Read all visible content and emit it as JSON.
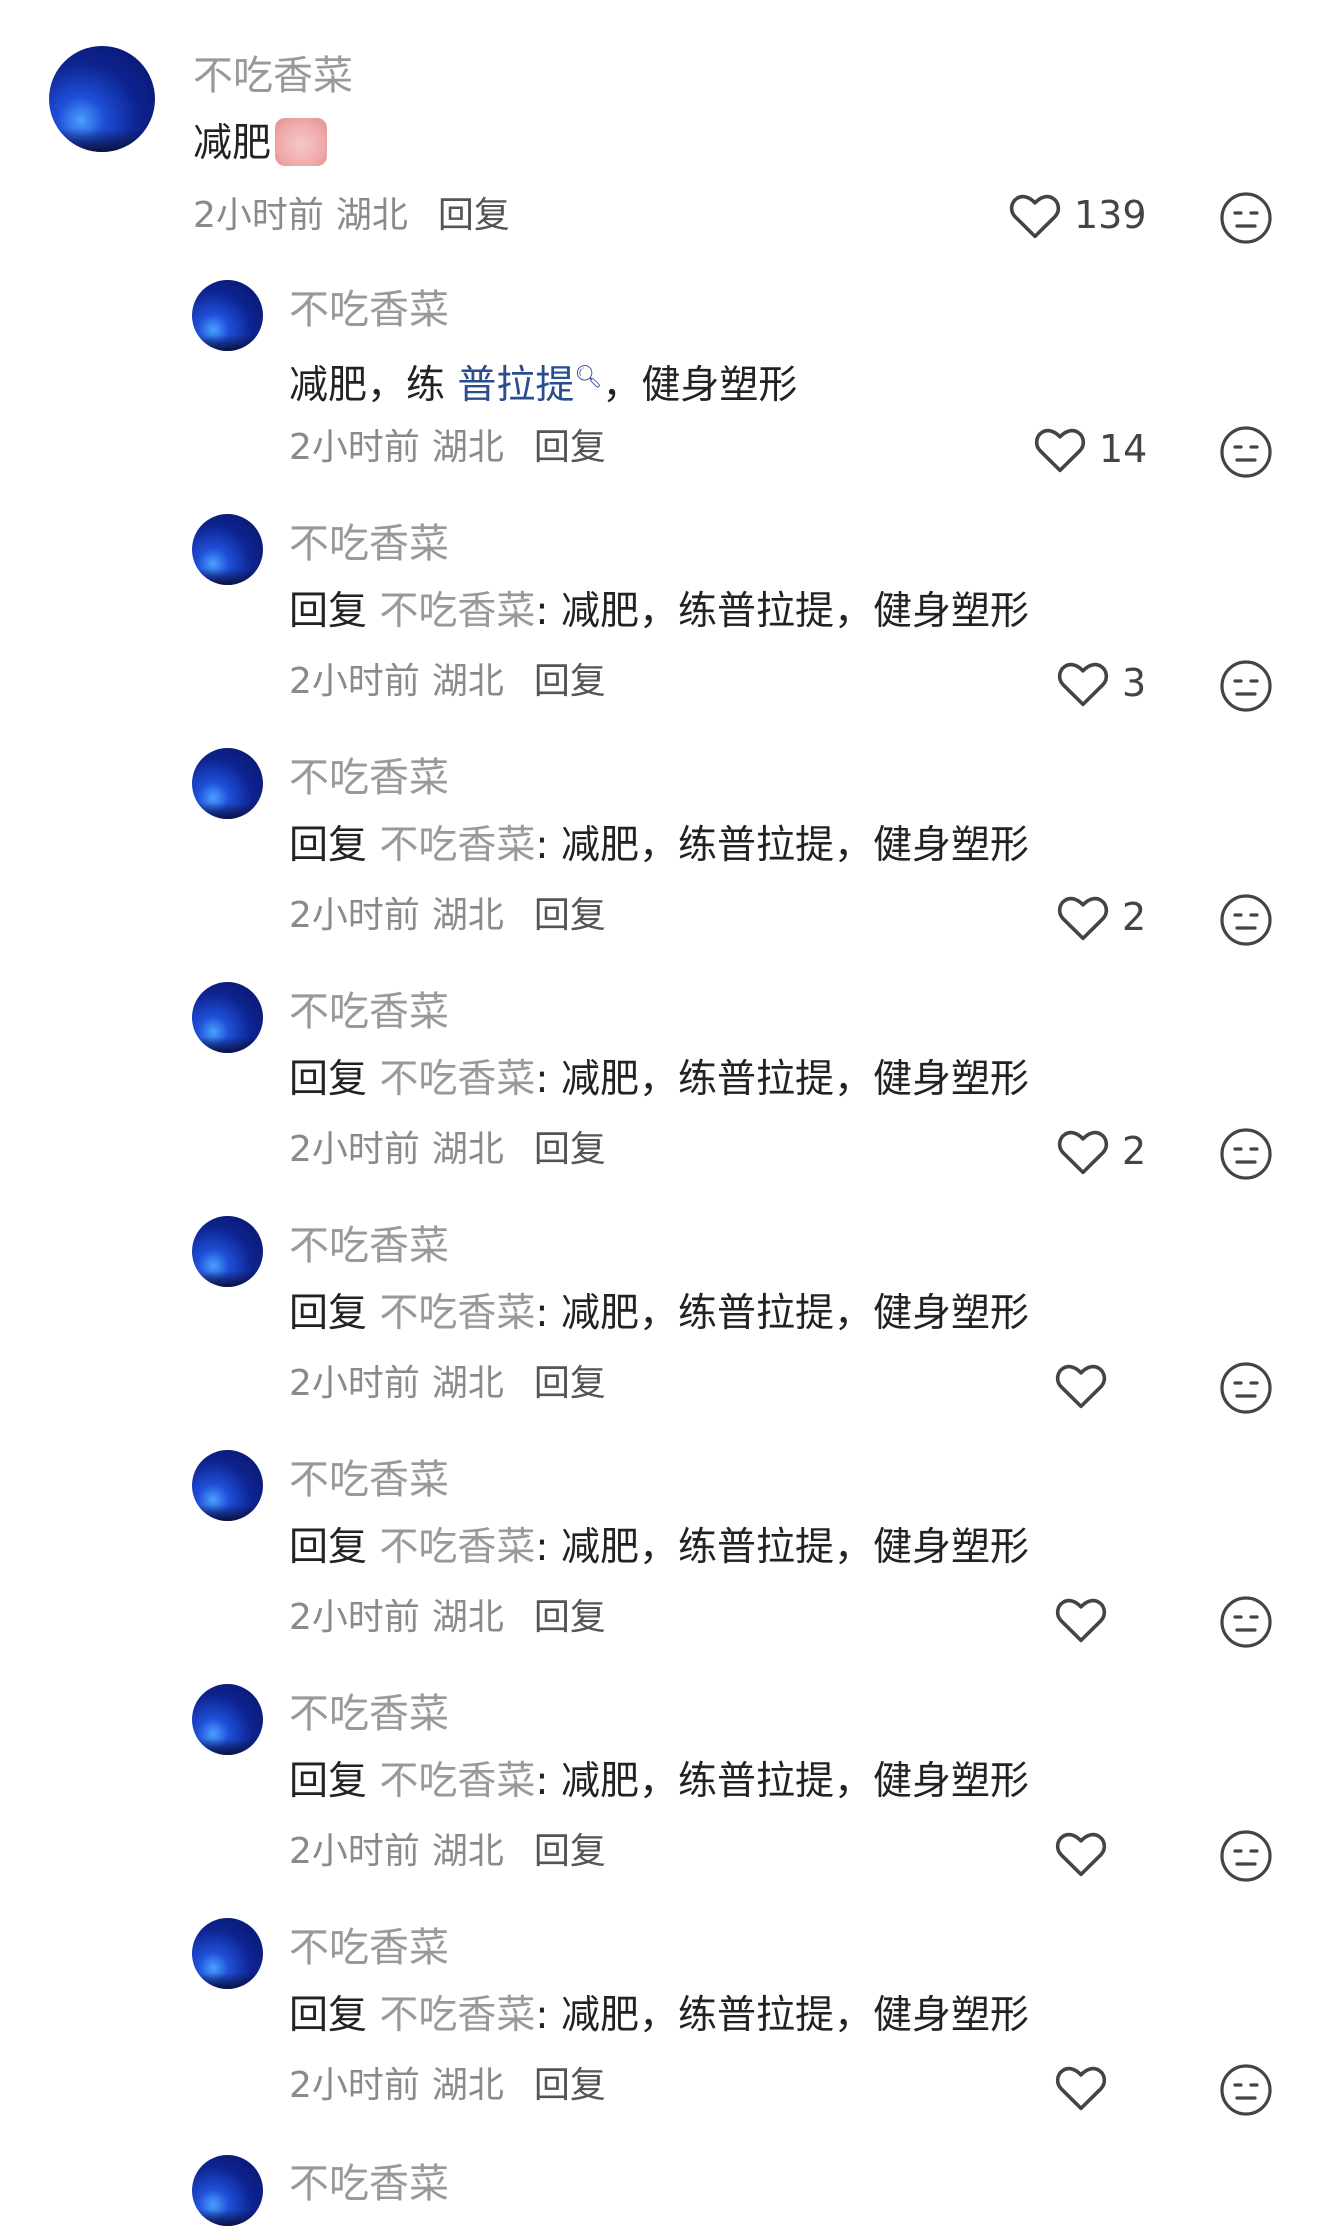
{
  "main_comment": {
    "user": "不吃香菜",
    "text": "减肥",
    "time": "2小时前",
    "region": "湖北",
    "reply_label": "回复",
    "likes": "139"
  },
  "replies": [
    {
      "user": "不吃香菜",
      "prefix": "",
      "ref_user": "",
      "text_before": "减肥，练 ",
      "topic": "普拉提",
      "text_after": "，健身塑形",
      "time": "2小时前",
      "region": "湖北",
      "reply_label": "回复",
      "likes": "14"
    },
    {
      "user": "不吃香菜",
      "prefix": "回复 ",
      "ref_user": "不吃香菜",
      "text": ": 减肥，练普拉提，健身塑形",
      "time": "2小时前",
      "region": "湖北",
      "reply_label": "回复",
      "likes": "3"
    },
    {
      "user": "不吃香菜",
      "prefix": "回复 ",
      "ref_user": "不吃香菜",
      "text": ": 减肥，练普拉提，健身塑形",
      "time": "2小时前",
      "region": "湖北",
      "reply_label": "回复",
      "likes": "2"
    },
    {
      "user": "不吃香菜",
      "prefix": "回复 ",
      "ref_user": "不吃香菜",
      "text": ": 减肥，练普拉提，健身塑形",
      "time": "2小时前",
      "region": "湖北",
      "reply_label": "回复",
      "likes": "2"
    },
    {
      "user": "不吃香菜",
      "prefix": "回复 ",
      "ref_user": "不吃香菜",
      "text": ": 减肥，练普拉提，健身塑形",
      "time": "2小时前",
      "region": "湖北",
      "reply_label": "回复",
      "likes": ""
    },
    {
      "user": "不吃香菜",
      "prefix": "回复 ",
      "ref_user": "不吃香菜",
      "text": ": 减肥，练普拉提，健身塑形",
      "time": "2小时前",
      "region": "湖北",
      "reply_label": "回复",
      "likes": ""
    },
    {
      "user": "不吃香菜",
      "prefix": "回复 ",
      "ref_user": "不吃香菜",
      "text": ": 减肥，练普拉提，健身塑形",
      "time": "2小时前",
      "region": "湖北",
      "reply_label": "回复",
      "likes": ""
    },
    {
      "user": "不吃香菜",
      "prefix": "回复 ",
      "ref_user": "不吃香菜",
      "text": ": 减肥，练普拉提，健身塑形",
      "time": "2小时前",
      "region": "湖北",
      "reply_label": "回复",
      "likes": ""
    }
  ],
  "partial_user": "不吃香菜",
  "icons": {
    "like": "heart-outline-icon",
    "dislike": "neutral-face-icon"
  },
  "colors": {
    "username": "#999999",
    "topic_link": "#2a4d8f",
    "avatar": "#1f4fd8"
  }
}
